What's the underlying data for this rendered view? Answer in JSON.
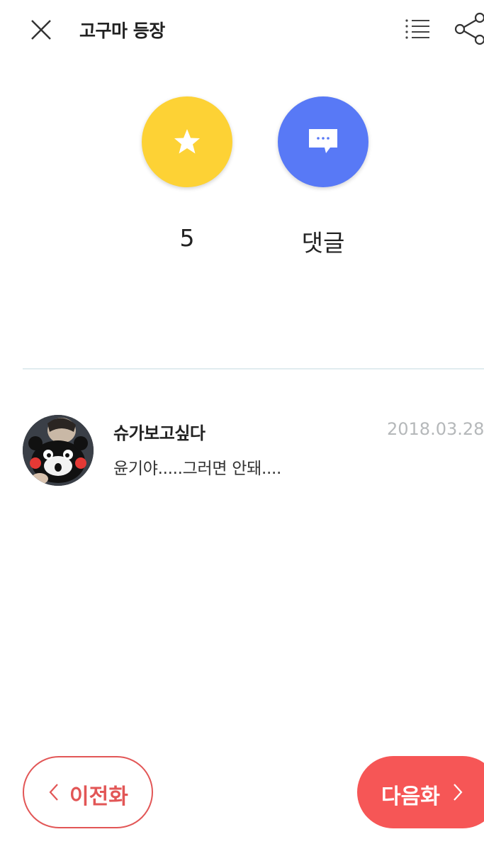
{
  "header": {
    "title": "고구마 등장",
    "close_icon": "close-icon",
    "list_icon": "list-icon",
    "share_icon": "share-icon"
  },
  "actions": {
    "star": {
      "icon": "star-icon",
      "count": "5",
      "color": "#fdd235"
    },
    "comment": {
      "icon": "comment-bubble-icon",
      "label": "댓글",
      "color": "#5879f6"
    }
  },
  "comments": [
    {
      "author": "슈가보고싶다",
      "date": "2018.03.28",
      "text": "윤기야.....그러면 안돼...."
    }
  ],
  "footer": {
    "prev_label": "이전화",
    "next_label": "다음화",
    "accent": "#f65656"
  }
}
